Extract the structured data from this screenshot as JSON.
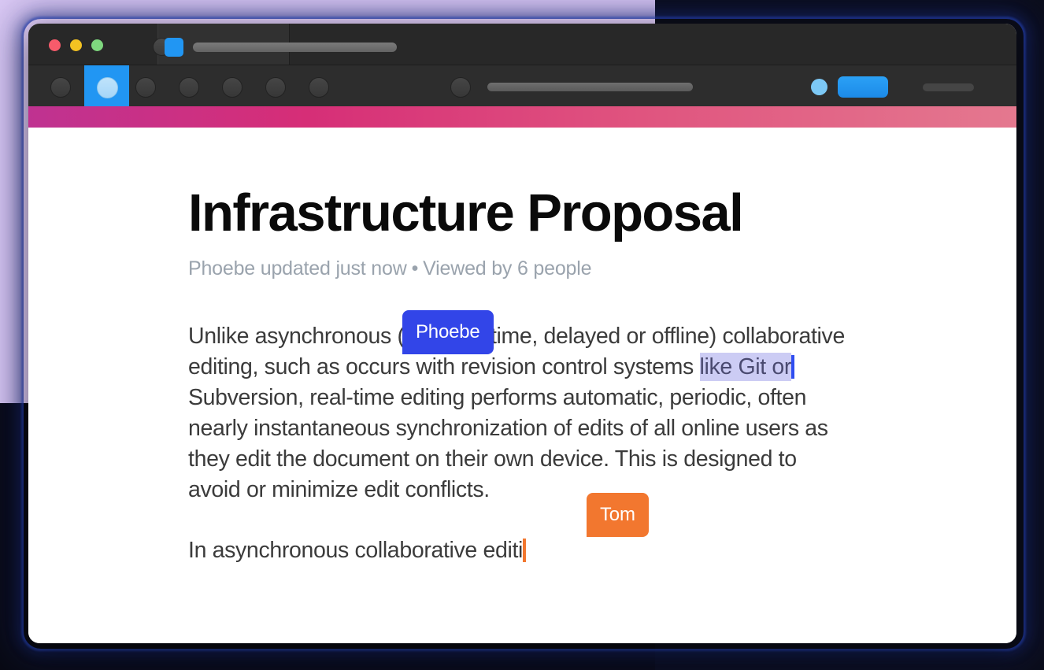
{
  "window": {
    "traffic_lights": [
      "close",
      "minimize",
      "zoom"
    ],
    "titlebar": {
      "app_icon": "blue-square-icon",
      "title_placeholder_bar": "title-bar-pill"
    },
    "toolbar": {
      "active_tab": "tab-1",
      "tab_count": 7,
      "search_bar": "toolbar-search-pill",
      "primary_button": "toolbar-primary-button"
    }
  },
  "document": {
    "title": "Infrastructure Proposal",
    "meta": {
      "updated_by": "Phoebe updated just now",
      "separator": "•",
      "viewers": "Viewed by 6 people"
    },
    "paragraph_1": {
      "before_selection": "Unlike asynchronous (non real-time, delayed or offline) collaborative editing, such as occurs with revision control systems ",
      "selection": "like Git or",
      "after_selection": "Subversion, real-time editing performs automatic, periodic, often nearly instantaneous synchronization of edits of all online users as they edit the document on their own device. This is designed to avoid or minimize edit conflicts."
    },
    "paragraph_2": "In asynchronous collaborative editi"
  },
  "collaborators": [
    {
      "name": "Phoebe",
      "color": "#3245e8"
    },
    {
      "name": "Tom",
      "color": "#f2772f"
    }
  ],
  "colors": {
    "accent_gradient_start": "#bf3291",
    "accent_gradient_end": "#e4788f",
    "selection_highlight": "#ccccf4",
    "tab_active": "#2196f3",
    "background_lilac": "#dccaf5",
    "background_navy": "#0b0d1a"
  }
}
